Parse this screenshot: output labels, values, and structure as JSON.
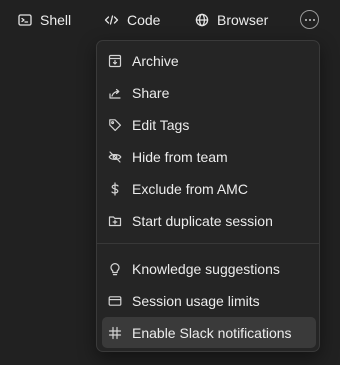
{
  "topbar": {
    "tabs": [
      {
        "label": "Shell",
        "icon": "terminal-icon"
      },
      {
        "label": "Code",
        "icon": "code-icon"
      },
      {
        "label": "Browser",
        "icon": "globe-icon"
      }
    ],
    "more_icon": "ellipsis-icon"
  },
  "menu": {
    "items": [
      {
        "label": "Archive",
        "icon": "archive-icon"
      },
      {
        "label": "Share",
        "icon": "share-icon"
      },
      {
        "label": "Edit Tags",
        "icon": "tag-icon"
      },
      {
        "label": "Hide from team",
        "icon": "eye-off-icon"
      },
      {
        "label": "Exclude from AMC",
        "icon": "dollar-icon"
      },
      {
        "label": "Start duplicate session",
        "icon": "folder-plus-icon"
      },
      {
        "label": "Knowledge suggestions",
        "icon": "lightbulb-icon"
      },
      {
        "label": "Session usage limits",
        "icon": "card-icon"
      },
      {
        "label": "Enable Slack notifications",
        "icon": "slack-icon",
        "highlighted": true
      }
    ]
  },
  "colors": {
    "background": "#212121",
    "menu_background": "#252525",
    "highlight": "#3a3a3a",
    "text": "#ececec"
  }
}
